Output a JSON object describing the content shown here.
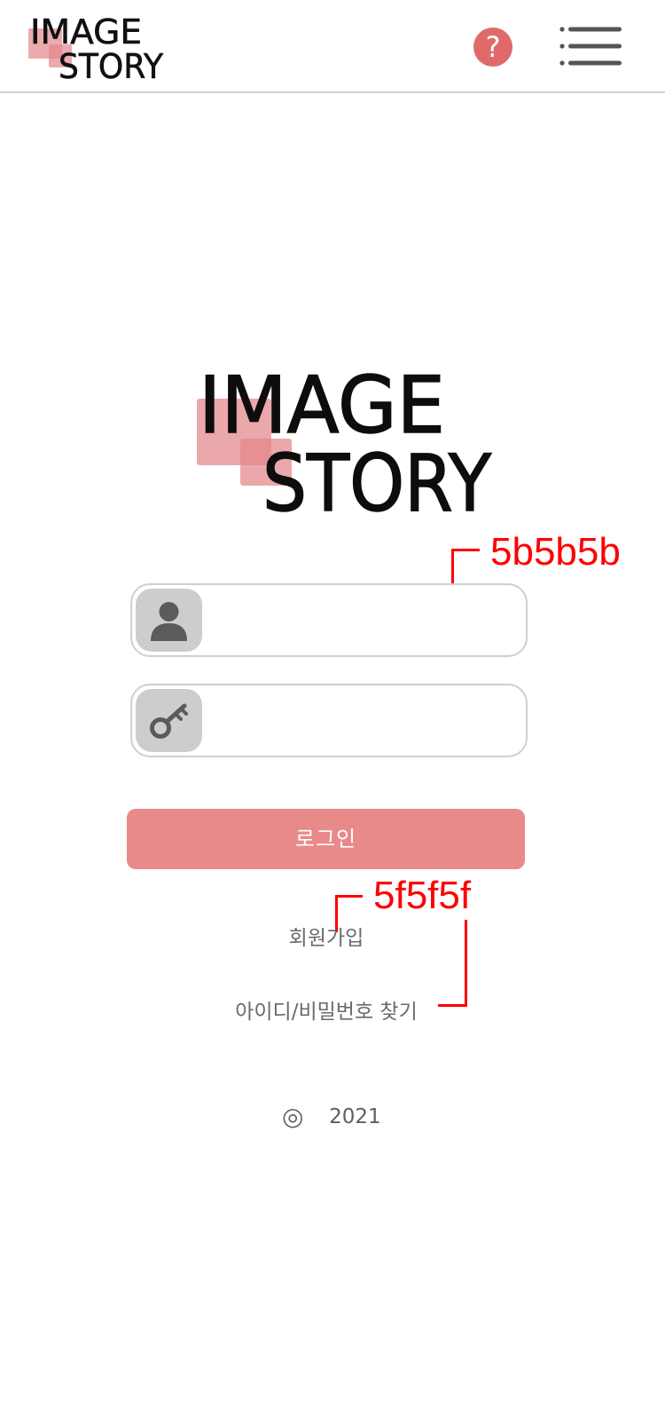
{
  "header": {
    "logo": {
      "line1": "IMAGE",
      "line2": "STORY"
    },
    "help_label": "?",
    "help_icon": "question-mark-icon",
    "menu_icon": "hamburger-menu-icon"
  },
  "main_logo": {
    "line1": "IMAGE",
    "line2": "STORY"
  },
  "login_form": {
    "id_field": {
      "value": "",
      "icon": "user-icon"
    },
    "password_field": {
      "value": "",
      "icon": "key-icon"
    },
    "login_button_label": "로그인"
  },
  "links": {
    "signup": "회원가입",
    "find_account": "아이디/비밀번호 찾기"
  },
  "footer": {
    "symbol": "◎",
    "year": "2021"
  },
  "annotations": {
    "border_color": "5b5b5b",
    "text_color": "5f5f5f"
  },
  "colors": {
    "accent": "#e06a6a",
    "button": "#e98a8a",
    "logo_square": "#e3868a",
    "icon_bg": "#cdcdcd",
    "icon_fg": "#5b5b5b",
    "border": "#cfcfcf",
    "annotation": "#ff0000"
  }
}
